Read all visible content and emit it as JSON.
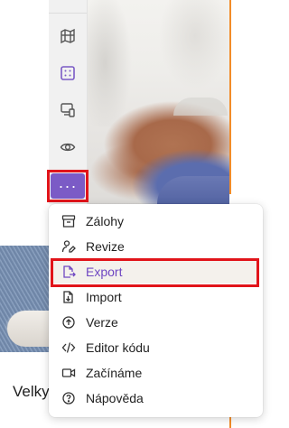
{
  "toolbar": {
    "icons": [
      "map-icon",
      "grid-select-icon",
      "responsive-devices-icon",
      "preview-eye-icon",
      "more-dots-icon"
    ],
    "more_label": "···"
  },
  "menu": {
    "items": [
      {
        "label": "Zálohy",
        "icon": "archive-icon"
      },
      {
        "label": "Revize",
        "icon": "user-edit-icon"
      },
      {
        "label": "Export",
        "icon": "export-file-icon",
        "active": true
      },
      {
        "label": "Import",
        "icon": "import-file-icon"
      },
      {
        "label": "Verze",
        "icon": "version-arrow-icon"
      },
      {
        "label": "Editor kódu",
        "icon": "code-icon"
      },
      {
        "label": "Začínáme",
        "icon": "video-icon"
      },
      {
        "label": "Nápověda",
        "icon": "help-icon"
      }
    ]
  },
  "page": {
    "product_title": "Velky"
  },
  "colors": {
    "accent": "#7b5bc6",
    "active_text": "#6f47c2",
    "highlight": "#e1141a",
    "canvas_line": "#f28c28"
  }
}
